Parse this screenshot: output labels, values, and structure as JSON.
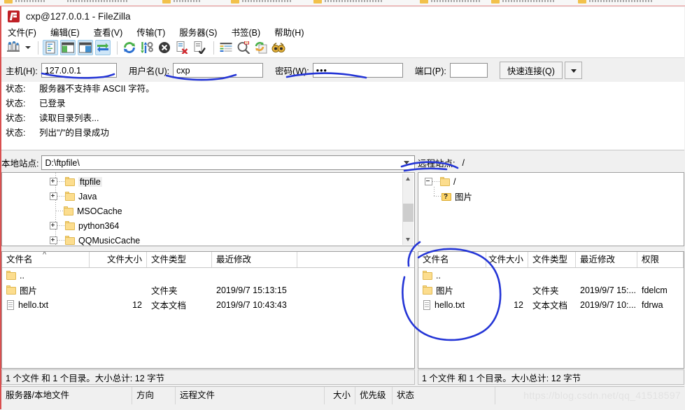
{
  "window": {
    "title": "cxp@127.0.0.1 - FileZilla",
    "logo_icon": "filezilla-logo-icon"
  },
  "menubar": {
    "items": [
      {
        "label": "文件(F)",
        "name": "menu-file"
      },
      {
        "label": "编辑(E)",
        "name": "menu-edit"
      },
      {
        "label": "查看(V)",
        "name": "menu-view"
      },
      {
        "label": "传输(T)",
        "name": "menu-transfer"
      },
      {
        "label": "服务器(S)",
        "name": "menu-server"
      },
      {
        "label": "书签(B)",
        "name": "menu-bookmarks"
      },
      {
        "label": "帮助(H)",
        "name": "menu-help"
      }
    ]
  },
  "toolbar": {
    "buttons": [
      {
        "icon": "site-manager-icon",
        "selected": false
      },
      {
        "icon": "site-manager-dropdown-icon",
        "selected": false
      },
      {
        "icon": "toggle-message-log-icon",
        "selected": true
      },
      {
        "icon": "toggle-local-tree-icon",
        "selected": true
      },
      {
        "icon": "toggle-remote-tree-icon",
        "selected": true
      },
      {
        "icon": "toggle-transfer-queue-icon",
        "selected": true
      },
      {
        "icon": "refresh-icon",
        "selected": false
      },
      {
        "icon": "process-queue-icon",
        "selected": false
      },
      {
        "icon": "cancel-operation-icon",
        "selected": false
      },
      {
        "icon": "disconnect-icon",
        "selected": false
      },
      {
        "icon": "reconnect-icon",
        "selected": false
      },
      {
        "icon": "filter-icon",
        "selected": false
      },
      {
        "icon": "directory-compare-icon",
        "selected": false
      },
      {
        "icon": "synchronized-browsing-icon",
        "selected": false
      },
      {
        "icon": "find-files-icon",
        "selected": false
      }
    ]
  },
  "quickconnect": {
    "host_label": "主机(H):",
    "host_value": "127.0.0.1",
    "user_label": "用户名(U):",
    "user_value": "cxp",
    "pass_label": "密码(W):",
    "pass_value": "•••",
    "port_label": "端口(P):",
    "port_value": "",
    "connect_label": "快速连接(Q)",
    "dropdown_icon": "chevron-down-icon"
  },
  "log": {
    "rows": [
      {
        "key": "状态:",
        "text": "服务器不支持非 ASCII 字符。"
      },
      {
        "key": "状态:",
        "text": "已登录"
      },
      {
        "key": "状态:",
        "text": "读取目录列表..."
      },
      {
        "key": "状态:",
        "text": "列出\"/\"的目录成功"
      }
    ]
  },
  "local": {
    "site_label": "本地站点:",
    "site_value": "D:\\ftpfile\\",
    "dropdown_icon": "chevron-down-icon",
    "tree": [
      {
        "label": "ftpfile",
        "expander": "plus",
        "icon": "folder-icon",
        "selected": true
      },
      {
        "label": "Java",
        "expander": "plus",
        "icon": "folder-icon",
        "selected": false
      },
      {
        "label": "MSOCache",
        "expander": "none",
        "icon": "folder-icon",
        "selected": false
      },
      {
        "label": "python364",
        "expander": "plus",
        "icon": "folder-icon",
        "selected": false
      },
      {
        "label": "QQMusicCache",
        "expander": "plus",
        "icon": "folder-icon",
        "selected": false
      }
    ],
    "columns": [
      "文件名",
      "文件大小",
      "文件类型",
      "最近修改"
    ],
    "rows": [
      {
        "name": "..",
        "size": "",
        "type": "",
        "modified": "",
        "icon": "folder-icon"
      },
      {
        "name": "图片",
        "size": "",
        "type": "文件夹",
        "modified": "2019/9/7 15:13:15",
        "icon": "folder-icon"
      },
      {
        "name": "hello.txt",
        "size": "12",
        "type": "文本文档",
        "modified": "2019/9/7 10:43:43",
        "icon": "file-icon"
      }
    ],
    "status": "1 个文件 和 1 个目录。大小总计: 12 字节"
  },
  "remote": {
    "site_label": "远程站点:",
    "site_value": "/",
    "tree": [
      {
        "label": "/",
        "expander": "minus",
        "icon": "folder-icon",
        "depth": 0
      },
      {
        "label": "图片",
        "expander": "none",
        "icon": "unknown-folder-icon",
        "depth": 1
      }
    ],
    "columns": [
      "文件名",
      "文件大小",
      "文件类型",
      "最近修改",
      "权限"
    ],
    "rows": [
      {
        "name": "..",
        "size": "",
        "type": "",
        "modified": "",
        "perms": "",
        "icon": "folder-icon"
      },
      {
        "name": "图片",
        "size": "",
        "type": "文件夹",
        "modified": "2019/9/7 15:...",
        "perms": "fdelcm",
        "icon": "folder-icon"
      },
      {
        "name": "hello.txt",
        "size": "12",
        "type": "文本文档",
        "modified": "2019/9/7 10:...",
        "perms": "fdrwa",
        "icon": "file-icon"
      }
    ],
    "status": "1 个文件 和 1 个目录。大小总计: 12 字节"
  },
  "queue": {
    "columns": [
      "服务器/本地文件",
      "方向",
      "远程文件",
      "大小",
      "优先级",
      "状态"
    ]
  },
  "watermark": "https://blog.csdn.net/qq_41518597",
  "annotation": {
    "ink_color": "#2435d6"
  }
}
